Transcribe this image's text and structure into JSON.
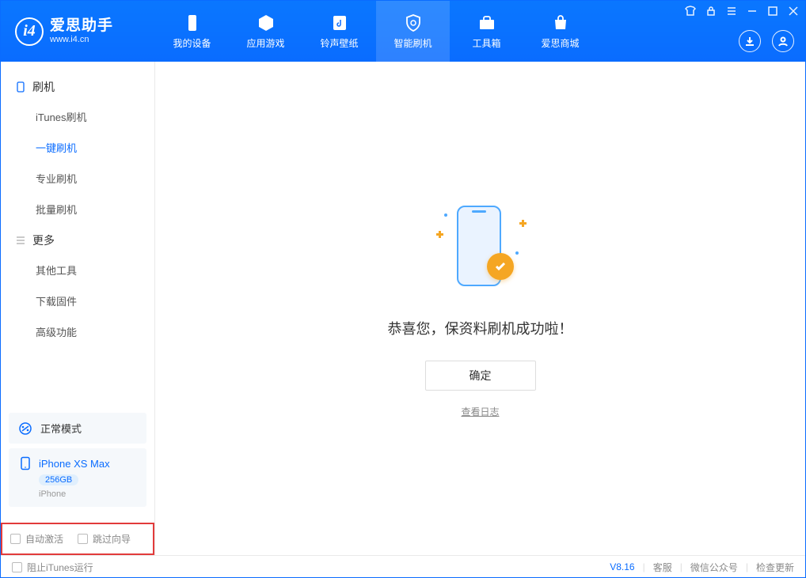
{
  "app": {
    "title": "爱思助手",
    "subtitle": "www.i4.cn"
  },
  "nav": {
    "items": [
      {
        "label": "我的设备"
      },
      {
        "label": "应用游戏"
      },
      {
        "label": "铃声壁纸"
      },
      {
        "label": "智能刷机"
      },
      {
        "label": "工具箱"
      },
      {
        "label": "爱思商城"
      }
    ]
  },
  "sidebar": {
    "group1": {
      "title": "刷机"
    },
    "items1": [
      {
        "label": "iTunes刷机"
      },
      {
        "label": "一键刷机"
      },
      {
        "label": "专业刷机"
      },
      {
        "label": "批量刷机"
      }
    ],
    "group2": {
      "title": "更多"
    },
    "items2": [
      {
        "label": "其他工具"
      },
      {
        "label": "下载固件"
      },
      {
        "label": "高级功能"
      }
    ]
  },
  "device": {
    "mode": "正常模式",
    "name": "iPhone XS Max",
    "capacity": "256GB",
    "type": "iPhone"
  },
  "options": {
    "auto_activate": "自动激活",
    "skip_guide": "跳过向导"
  },
  "main": {
    "success_msg": "恭喜您，保资料刷机成功啦！",
    "ok_label": "确定",
    "view_log": "查看日志"
  },
  "statusbar": {
    "block_itunes": "阻止iTunes运行",
    "version": "V8.16",
    "support": "客服",
    "wechat": "微信公众号",
    "check_update": "检查更新"
  }
}
